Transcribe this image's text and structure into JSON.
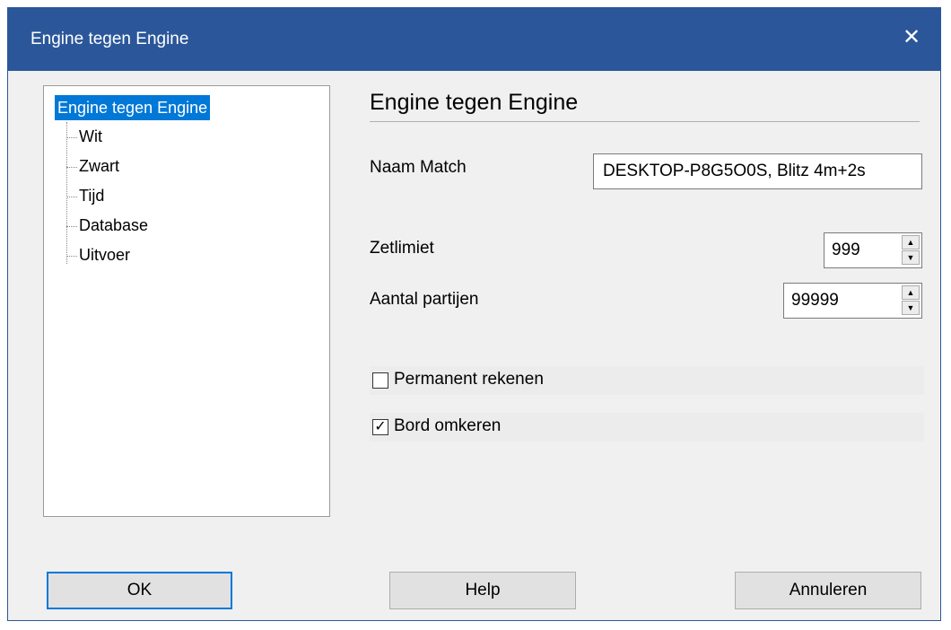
{
  "window": {
    "title": "Engine tegen Engine",
    "close_glyph": "✕"
  },
  "tree": {
    "root_label": "Engine tegen Engine",
    "children": [
      "Wit",
      "Zwart",
      "Tijd",
      "Database",
      "Uitvoer"
    ]
  },
  "panel": {
    "heading": "Engine tegen Engine",
    "match_name_label": "Naam Match",
    "match_name_value": "DESKTOP-P8G5O0S, Blitz 4m+2s",
    "move_limit_label": "Zetlimiet",
    "move_limit_value": "999",
    "games_label": "Aantal partijen",
    "games_value": "99999",
    "permanent_label": "Permanent rekenen",
    "permanent_checked": false,
    "flip_label": "Bord omkeren",
    "flip_checked": true,
    "check_glyph": "✓"
  },
  "buttons": {
    "ok": "OK",
    "help": "Help",
    "cancel": "Annuleren"
  },
  "colors": {
    "titlebar": "#2b579a",
    "selection": "#0078d7",
    "dialog_bg": "#f0f0f0"
  }
}
